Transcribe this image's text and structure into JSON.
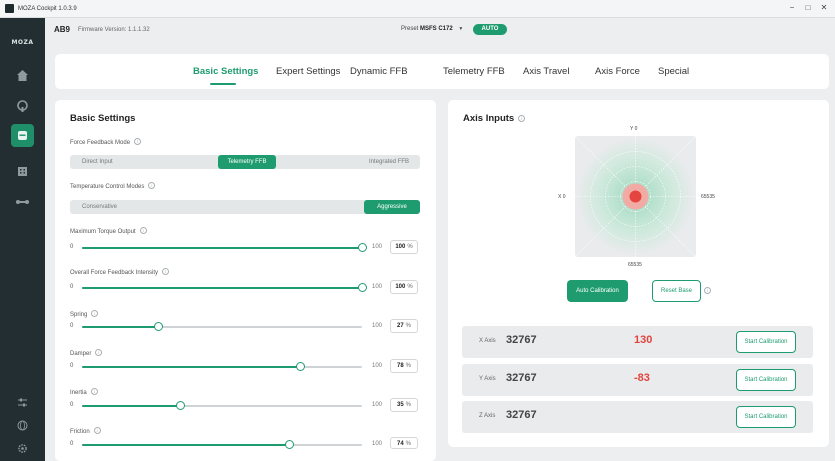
{
  "window": {
    "title": "MOZA Cockpit 1.0.3.9",
    "minimize": "−",
    "maximize": "□",
    "close": "✕"
  },
  "sidebar": {
    "logo": "MOZA",
    "items": [
      {
        "icon": "home-icon",
        "active": false
      },
      {
        "icon": "wheel-icon",
        "active": false
      },
      {
        "icon": "base-device-icon",
        "active": true
      },
      {
        "icon": "building-icon",
        "active": false
      },
      {
        "icon": "pedals-icon",
        "active": false
      }
    ],
    "bottom": [
      {
        "icon": "sliders-icon"
      },
      {
        "icon": "globe-icon"
      },
      {
        "icon": "gear-icon"
      }
    ]
  },
  "header": {
    "model": "AB9",
    "firmware": "Firmware Version: 1.1.1.32",
    "preset_label": "Preset",
    "preset_value": "MSFS C172",
    "badge": "AUTO"
  },
  "tabs": [
    {
      "label": "Basic Settings",
      "active": true
    },
    {
      "label": "Expert Settings",
      "active": false
    },
    {
      "label": "Dynamic FFB",
      "active": false
    },
    {
      "label": "Telemetry FFB",
      "active": false
    },
    {
      "label": "Axis Travel",
      "active": false
    },
    {
      "label": "Axis Force",
      "active": false
    },
    {
      "label": "Special",
      "active": false
    }
  ],
  "basic": {
    "title": "Basic Settings",
    "ffb_mode": {
      "label": "Force Feedback Mode",
      "options": [
        "Direct Input",
        "Telemetry FFB",
        "Integrated FFB"
      ],
      "selected": "Telemetry FFB"
    },
    "temp_mode": {
      "label": "Temperature Control Modes",
      "options": [
        "Conservative",
        "Aggressive"
      ],
      "selected": "Aggressive"
    },
    "sliders": [
      {
        "label": "Maximum Torque Output",
        "min": "0",
        "max": "100",
        "value": 100,
        "value_text": "100",
        "unit": "%"
      },
      {
        "label": "Overall Force Feedback Intensity",
        "min": "0",
        "max": "100",
        "value": 100,
        "value_text": "100",
        "unit": "%"
      },
      {
        "label": "Spring",
        "min": "0",
        "max": "100",
        "value": 27,
        "value_text": "27",
        "unit": "%"
      },
      {
        "label": "Damper",
        "min": "0",
        "max": "100",
        "value": 78,
        "value_text": "78",
        "unit": "%"
      },
      {
        "label": "Inertia",
        "min": "0",
        "max": "100",
        "value": 35,
        "value_text": "35",
        "unit": "%"
      },
      {
        "label": "Friction",
        "min": "0",
        "max": "100",
        "value": 74,
        "value_text": "74",
        "unit": "%"
      }
    ],
    "accent": "#1f9c6f"
  },
  "axis_inputs": {
    "title": "Axis Inputs",
    "y_top": "Y 0",
    "x_left": "X 0",
    "x_right": "65535",
    "y_bottom": "65535",
    "auto_calibration": "Auto Calibration",
    "reset_base": "Reset Base",
    "axes": [
      {
        "name": "X Axis",
        "raw": "32767",
        "position": "130",
        "button": "Start Calibration"
      },
      {
        "name": "Y Axis",
        "raw": "32767",
        "position": "-83",
        "button": "Start Calibration"
      },
      {
        "name": "Z Axis",
        "raw": "32767",
        "position": "",
        "button": "Start Calibration"
      }
    ]
  }
}
